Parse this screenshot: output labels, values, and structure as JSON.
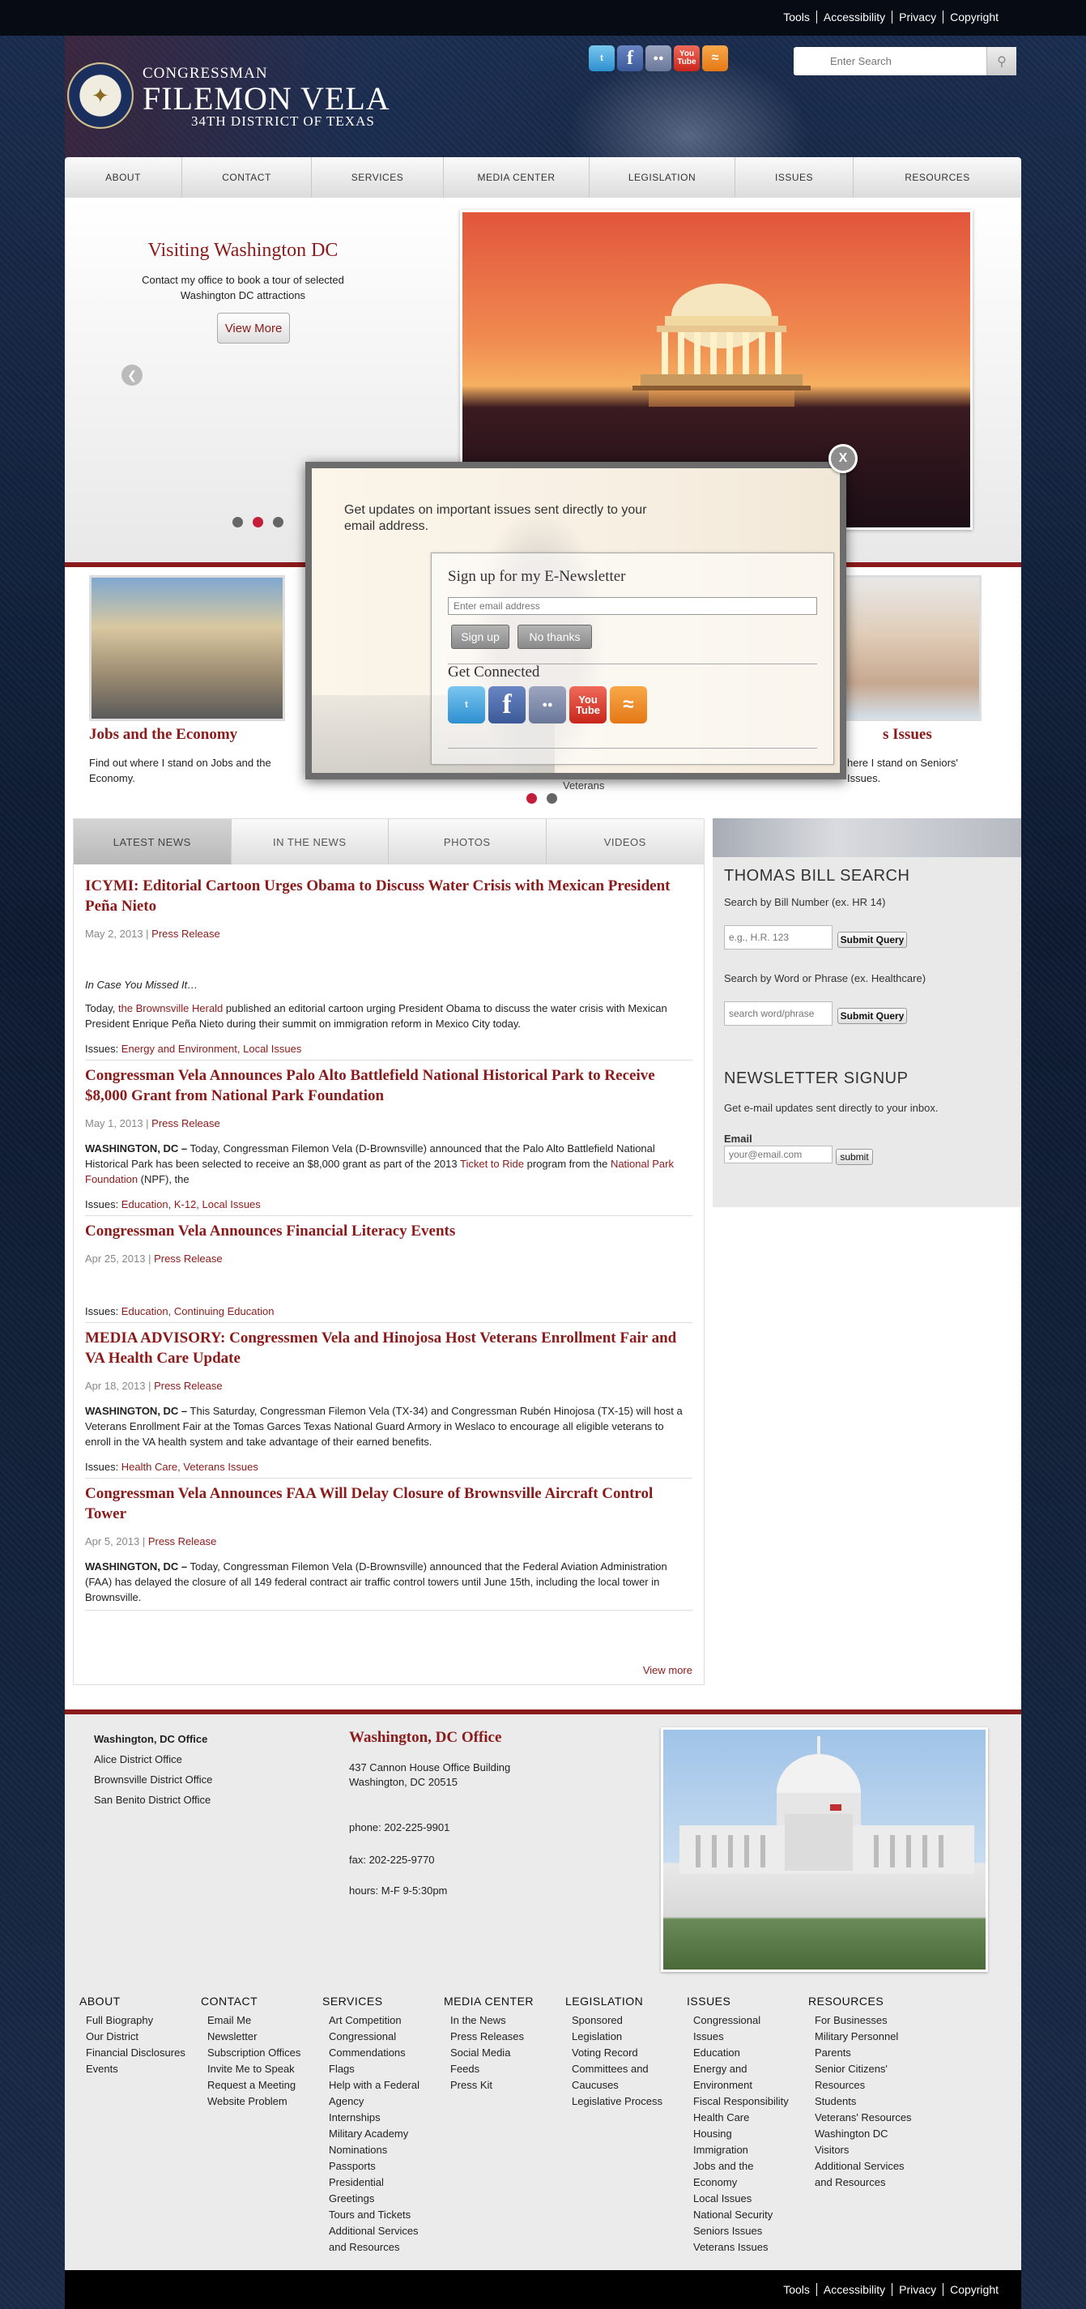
{
  "utility": [
    "Tools",
    "Accessibility",
    "Privacy",
    "Copyright"
  ],
  "brand": {
    "small": "CONGRESSMAN",
    "big": "FILEMON VELA",
    "district": "34TH DISTRICT OF TEXAS"
  },
  "search": {
    "placeholder": "Enter Search"
  },
  "nav": [
    "ABOUT",
    "CONTACT",
    "SERVICES",
    "MEDIA CENTER",
    "LEGISLATION",
    "ISSUES",
    "RESOURCES"
  ],
  "hero": {
    "title": "Visiting Washington DC",
    "desc": "Contact my office to book a tour of selected Washington DC attractions",
    "button": "View More"
  },
  "features": [
    {
      "title": "Jobs and the Economy",
      "desc": "Find out where I stand on Jobs and the Economy."
    },
    {
      "title": "s Issues",
      "desc": "here I stand on Seniors' Issues."
    }
  ],
  "feature_hidden_text": "Veterans",
  "popup": {
    "intro": "Get updates on important issues sent directly to your email address.",
    "heading": "Sign up for my E-Newsletter",
    "email_placeholder": "Enter email address",
    "signup": "Sign up",
    "nothanks": "No thanks",
    "connect": "Get Connected",
    "close": "X"
  },
  "tabs": [
    "LATEST NEWS",
    "IN THE NEWS",
    "PHOTOS",
    "VIDEOS"
  ],
  "articles": [
    {
      "title": "ICYMI: Editorial Cartoon Urges Obama to Discuss Water Crisis with Mexican President Peña Nieto",
      "date": "May 2, 2013",
      "type": "Press Release",
      "lead": "In Case You Missed It…",
      "body_pre": "Today, ",
      "body_link": "the Brownsville Herald",
      "body_post": " published an editorial cartoon urging President Obama to discuss the water crisis with Mexican President Enrique Peña Nieto during their summit on immigration reform in Mexico City today.",
      "issues": "Energy and Environment, Local Issues"
    },
    {
      "title": "Congressman Vela Announces Palo Alto Battlefield National Historical Park to Receive $8,000 Grant from National Park Foundation",
      "date": "May 1, 2013",
      "type": "Press Release",
      "dateline": "WASHINGTON, DC –",
      "body_pre": " Today, Congressman Filemon Vela (D-Brownsville) announced that the Palo Alto Battlefield National Historical Park has been selected to receive an $8,000 grant as part of the 2013 ",
      "body_link1": "Ticket to Ride",
      "body_mid": " program from the ",
      "body_link2": "National Park Foundation",
      "body_post": " (NPF), the",
      "issues": "Education, K-12, Local Issues"
    },
    {
      "title": "Congressman Vela Announces Financial Literacy Events",
      "date": "Apr 25, 2013",
      "type": "Press Release",
      "issues": "Education, Continuing Education"
    },
    {
      "title": "MEDIA ADVISORY: Congressmen Vela and Hinojosa Host Veterans Enrollment Fair and VA Health Care Update",
      "date": "Apr 18, 2013",
      "type": "Press Release",
      "dateline": "WASHINGTON, DC –",
      "body": " This Saturday, Congressman Filemon Vela (TX-34) and Congressman Rubén Hinojosa (TX-15) will host a Veterans Enrollment Fair at the Tomas Garces Texas National Guard Armory in Weslaco to encourage all eligible veterans to enroll in the VA health system and take advantage of their earned benefits.",
      "issues": "Health Care, Veterans Issues"
    },
    {
      "title": "Congressman Vela Announces FAA Will Delay Closure of Brownsville Aircraft Control Tower",
      "date": "Apr 5, 2013",
      "type": "Press Release",
      "dateline": "WASHINGTON, DC –",
      "body": " Today, Congressman Filemon Vela (D-Brownsville) announced that the Federal Aviation Administration (FAA) has delayed the closure of all 149 federal contract air traffic control towers until June 15th, including the local tower in Brownsville."
    }
  ],
  "issues_label": "Issues: ",
  "view_more": "View more",
  "sidebar": {
    "thomas_title": "THOMAS BILL SEARCH",
    "by_number": "Search by Bill Number (ex. HR 14)",
    "number_placeholder": "e.g., H.R. 123",
    "submit": "Submit Query",
    "by_word": "Search by Word or Phrase (ex. Healthcare)",
    "word_placeholder": "search word/phrase",
    "newsletter_title": "NEWSLETTER SIGNUP",
    "newsletter_desc": "Get e-mail updates sent directly to your inbox.",
    "email_label": "Email",
    "email_placeholder": "your@email.com",
    "email_submit": "submit"
  },
  "offices": [
    "Washington, DC Office",
    "Alice District Office",
    "Brownsville District Office",
    "San Benito District Office"
  ],
  "office_detail": {
    "title": "Washington, DC Office",
    "address1": "437 Cannon House Office Building",
    "address2": "Washington, DC 20515",
    "phone": "phone: 202-225-9901",
    "fax": "fax: 202-225-9770",
    "hours": "hours: M-F 9-5:30pm"
  },
  "footer_cols": [
    {
      "heading": "ABOUT",
      "links": [
        "Full Biography",
        "Our District",
        "Financial Disclosures",
        "Events"
      ]
    },
    {
      "heading": "CONTACT",
      "links": [
        "Email Me",
        "Newsletter Subscription Offices",
        "Invite Me to Speak",
        "Request a Meeting",
        "Website Problem"
      ]
    },
    {
      "heading": "SERVICES",
      "links": [
        "Art Competition",
        "Congressional Commendations",
        "Flags",
        "Help with a Federal Agency",
        "Internships",
        "Military Academy Nominations",
        "Passports",
        "Presidential Greetings",
        "Tours and Tickets",
        "Additional Services and Resources"
      ]
    },
    {
      "heading": "MEDIA CENTER",
      "links": [
        "In the News",
        "Press Releases",
        "Social Media",
        "Feeds",
        "Press Kit"
      ]
    },
    {
      "heading": "LEGISLATION",
      "links": [
        "Sponsored Legislation",
        "Voting Record",
        "Committees and Caucuses",
        "Legislative Process"
      ]
    },
    {
      "heading": "ISSUES",
      "links": [
        "Congressional Issues",
        "Education",
        "Energy and Environment",
        "Fiscal Responsibility",
        "Health Care",
        "Housing",
        "Immigration",
        "Jobs and the Economy",
        "Local Issues",
        "National Security",
        "Seniors Issues",
        "Veterans Issues"
      ]
    },
    {
      "heading": "RESOURCES",
      "links": [
        "For Businesses",
        "Military Personnel",
        "Parents",
        "Senior Citizens' Resources",
        "Students",
        "Veterans' Resources",
        "Washington DC Visitors",
        "Additional Services and Resources"
      ]
    }
  ],
  "colors": {
    "accent": "#8b1a1a",
    "navy": "#0f1c33",
    "dot_active": "#c41e3a"
  }
}
